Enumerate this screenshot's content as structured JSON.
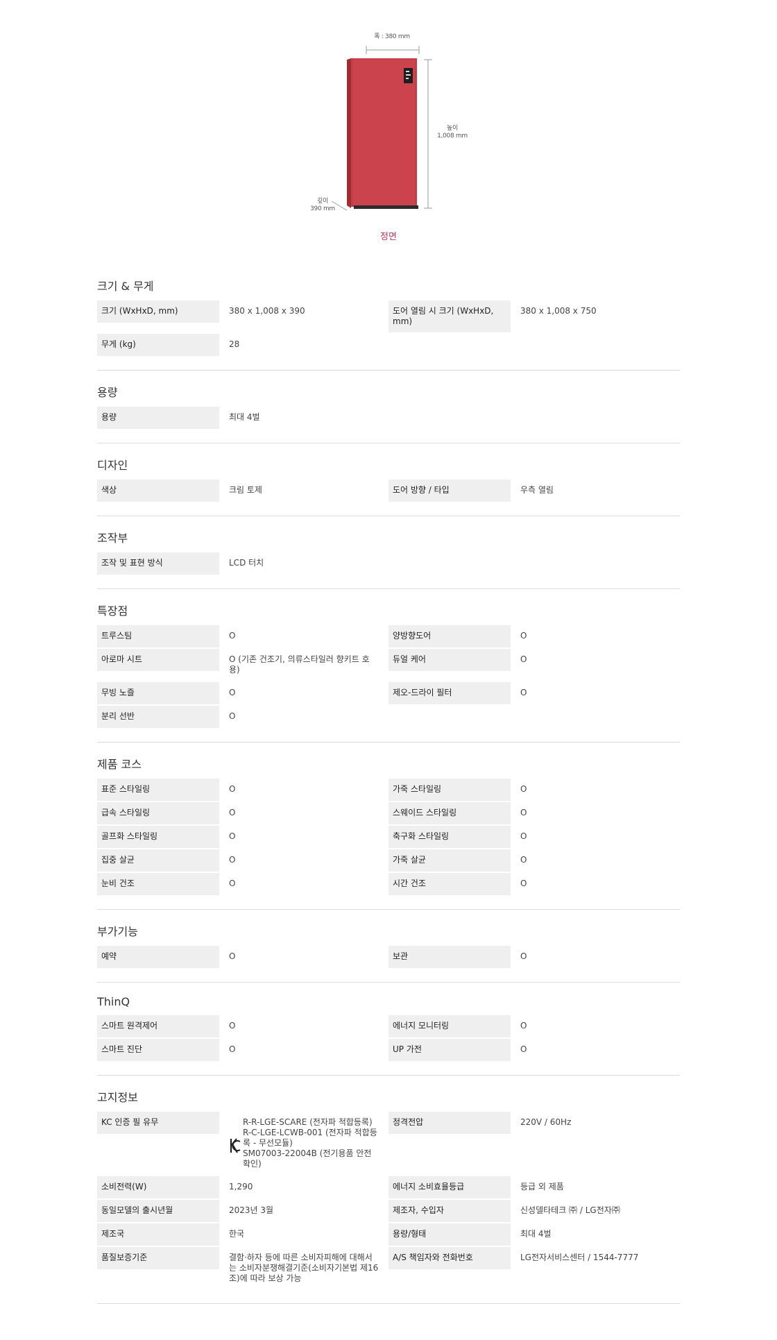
{
  "product": {
    "width_label": "폭 : 380 mm",
    "height_label_1": "높이",
    "height_label_2": "1,008 mm",
    "depth_label_1": "깊이",
    "depth_label_2": "390 mm",
    "view_label": "정면",
    "colors": {
      "body": "#c63c47",
      "body_side": "#a02c36",
      "base": "#2b2b2b"
    }
  },
  "sections": [
    {
      "title": "크기 & 무게",
      "rows": [
        {
          "label": "크기 (WxHxD, mm)",
          "value": "380 x 1,008 x 390"
        },
        {
          "label": "도어 열림 시 크기 (WxHxD, mm)",
          "value": "380 x 1,008 x 750"
        },
        {
          "label": "무게 (kg)",
          "value": "28"
        }
      ]
    },
    {
      "title": "용량",
      "rows": [
        {
          "label": "용량",
          "value": "최대 4벌"
        }
      ]
    },
    {
      "title": "디자인",
      "rows": [
        {
          "label": "색상",
          "value": "크림 토제"
        },
        {
          "label": "도어 방향 / 타입",
          "value": "우측 열림"
        }
      ]
    },
    {
      "title": "조작부",
      "rows": [
        {
          "label": "조작 및 표현 방식",
          "value": "LCD 터치"
        }
      ]
    },
    {
      "title": "특장점",
      "rows": [
        {
          "label": "트루스팀",
          "value": "O"
        },
        {
          "label": "양방향도어",
          "value": "O"
        },
        {
          "label": "아로마 시트",
          "value": "O (기존 건조기, 의류스타일러 향키트 호용)"
        },
        {
          "label": "듀얼 케어",
          "value": "O"
        },
        {
          "label": "무빙 노즐",
          "value": "O"
        },
        {
          "label": "제오-드라이 필터",
          "value": "O"
        },
        {
          "label": "분리 선반",
          "value": "O"
        }
      ]
    },
    {
      "title": "제품 코스",
      "rows": [
        {
          "label": "표준 스타일링",
          "value": "O"
        },
        {
          "label": "가죽 스타일링",
          "value": "O"
        },
        {
          "label": "급속 스타일링",
          "value": "O"
        },
        {
          "label": "스웨이드 스타일링",
          "value": "O"
        },
        {
          "label": "골프화 스타일링",
          "value": "O"
        },
        {
          "label": "축구화 스타일링",
          "value": "O"
        },
        {
          "label": "집중 살균",
          "value": "O"
        },
        {
          "label": "가죽 살균",
          "value": "O"
        },
        {
          "label": "눈비 건조",
          "value": "O"
        },
        {
          "label": "시간 건조",
          "value": "O"
        }
      ]
    },
    {
      "title": "부가기능",
      "rows": [
        {
          "label": "예약",
          "value": "O"
        },
        {
          "label": "보관",
          "value": "O"
        }
      ]
    },
    {
      "title": "ThinQ",
      "rows": [
        {
          "label": "스마트 원격제어",
          "value": "O"
        },
        {
          "label": "에너지 모니터링",
          "value": "O"
        },
        {
          "label": "스마트 진단",
          "value": "O"
        },
        {
          "label": "UP 가전",
          "value": "O"
        }
      ]
    },
    {
      "title": "고지정보",
      "rows": [
        {
          "label": "KC 인증 필 유무",
          "value": "",
          "kc": true,
          "kc_lines": [
            "R-R-LGE-SCARE (전자파 적합등록)",
            "R-C-LGE-LCWB-001 (전자파 적합등록 - 무선모듈)",
            "SM07003-22004B (전기용품 안전확인)"
          ]
        },
        {
          "label": "정격전압",
          "value": "220V / 60Hz"
        },
        {
          "label": "소비전력(W)",
          "value": "1,290"
        },
        {
          "label": "에너지 소비효율등급",
          "value": "등급 외 제품"
        },
        {
          "label": "동일모델의 출시년월",
          "value": "2023년 3월"
        },
        {
          "label": "제조자, 수입자",
          "value": "신성델타테크 ㈜ / LG전자㈜"
        },
        {
          "label": "제조국",
          "value": "한국"
        },
        {
          "label": "용량/형태",
          "value": "최대 4벌"
        },
        {
          "label": "품질보증기준",
          "value": "결함·하자 등에 따른 소비자피해에 대해서는 소비자분쟁해결기준(소비자기본법 제16조)에 따라 보상 가능"
        },
        {
          "label": "A/S 책임자와 전화번호",
          "value": "LG전자서비스센터 / 1544-7777"
        }
      ]
    }
  ]
}
